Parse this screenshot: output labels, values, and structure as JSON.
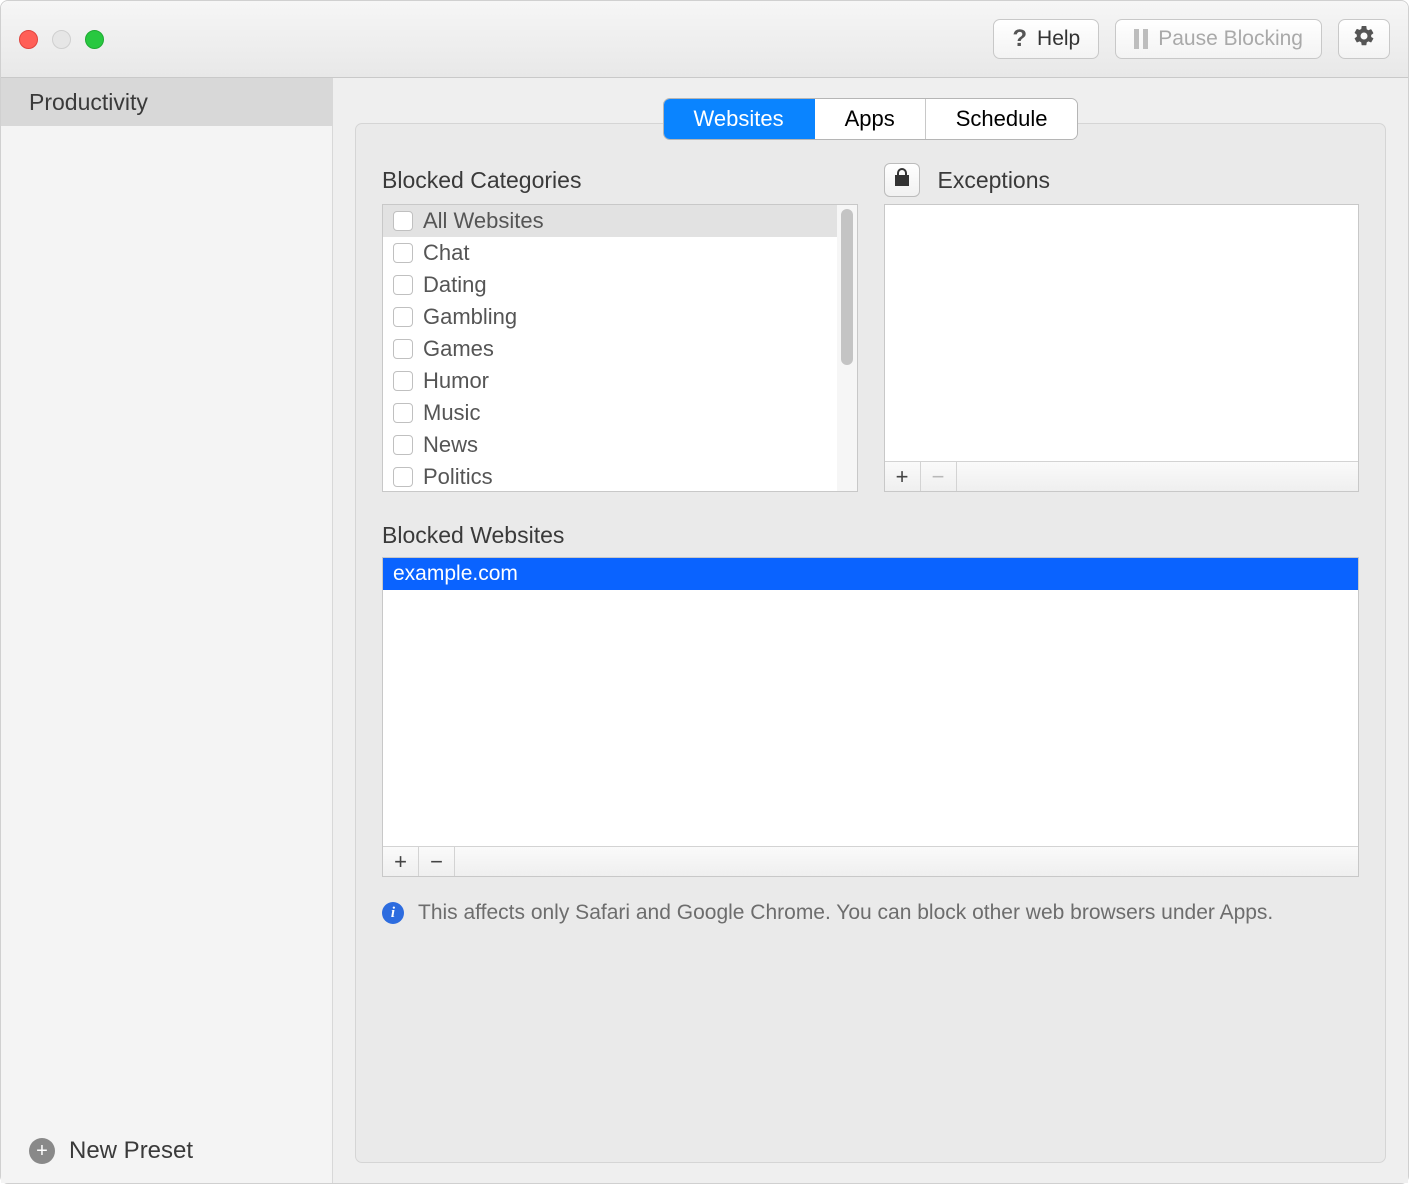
{
  "toolbar": {
    "help_label": "Help",
    "pause_label": "Pause Blocking"
  },
  "sidebar": {
    "items": [
      {
        "label": "Productivity"
      }
    ],
    "new_preset_label": "New Preset"
  },
  "tabs": {
    "items": [
      {
        "label": "Websites",
        "active": true
      },
      {
        "label": "Apps",
        "active": false
      },
      {
        "label": "Schedule",
        "active": false
      }
    ]
  },
  "panel": {
    "categories_label": "Blocked Categories",
    "exceptions_label": "Exceptions",
    "categories": [
      {
        "label": "All Websites",
        "selected": true
      },
      {
        "label": "Chat"
      },
      {
        "label": "Dating"
      },
      {
        "label": "Gambling"
      },
      {
        "label": "Games"
      },
      {
        "label": "Humor"
      },
      {
        "label": "Music"
      },
      {
        "label": "News"
      },
      {
        "label": "Politics"
      }
    ],
    "blocked_websites_label": "Blocked Websites",
    "blocked_websites": [
      {
        "label": "example.com",
        "selected": true
      }
    ],
    "info_text": "This affects only Safari and Google Chrome. You can block other web browsers under Apps."
  }
}
